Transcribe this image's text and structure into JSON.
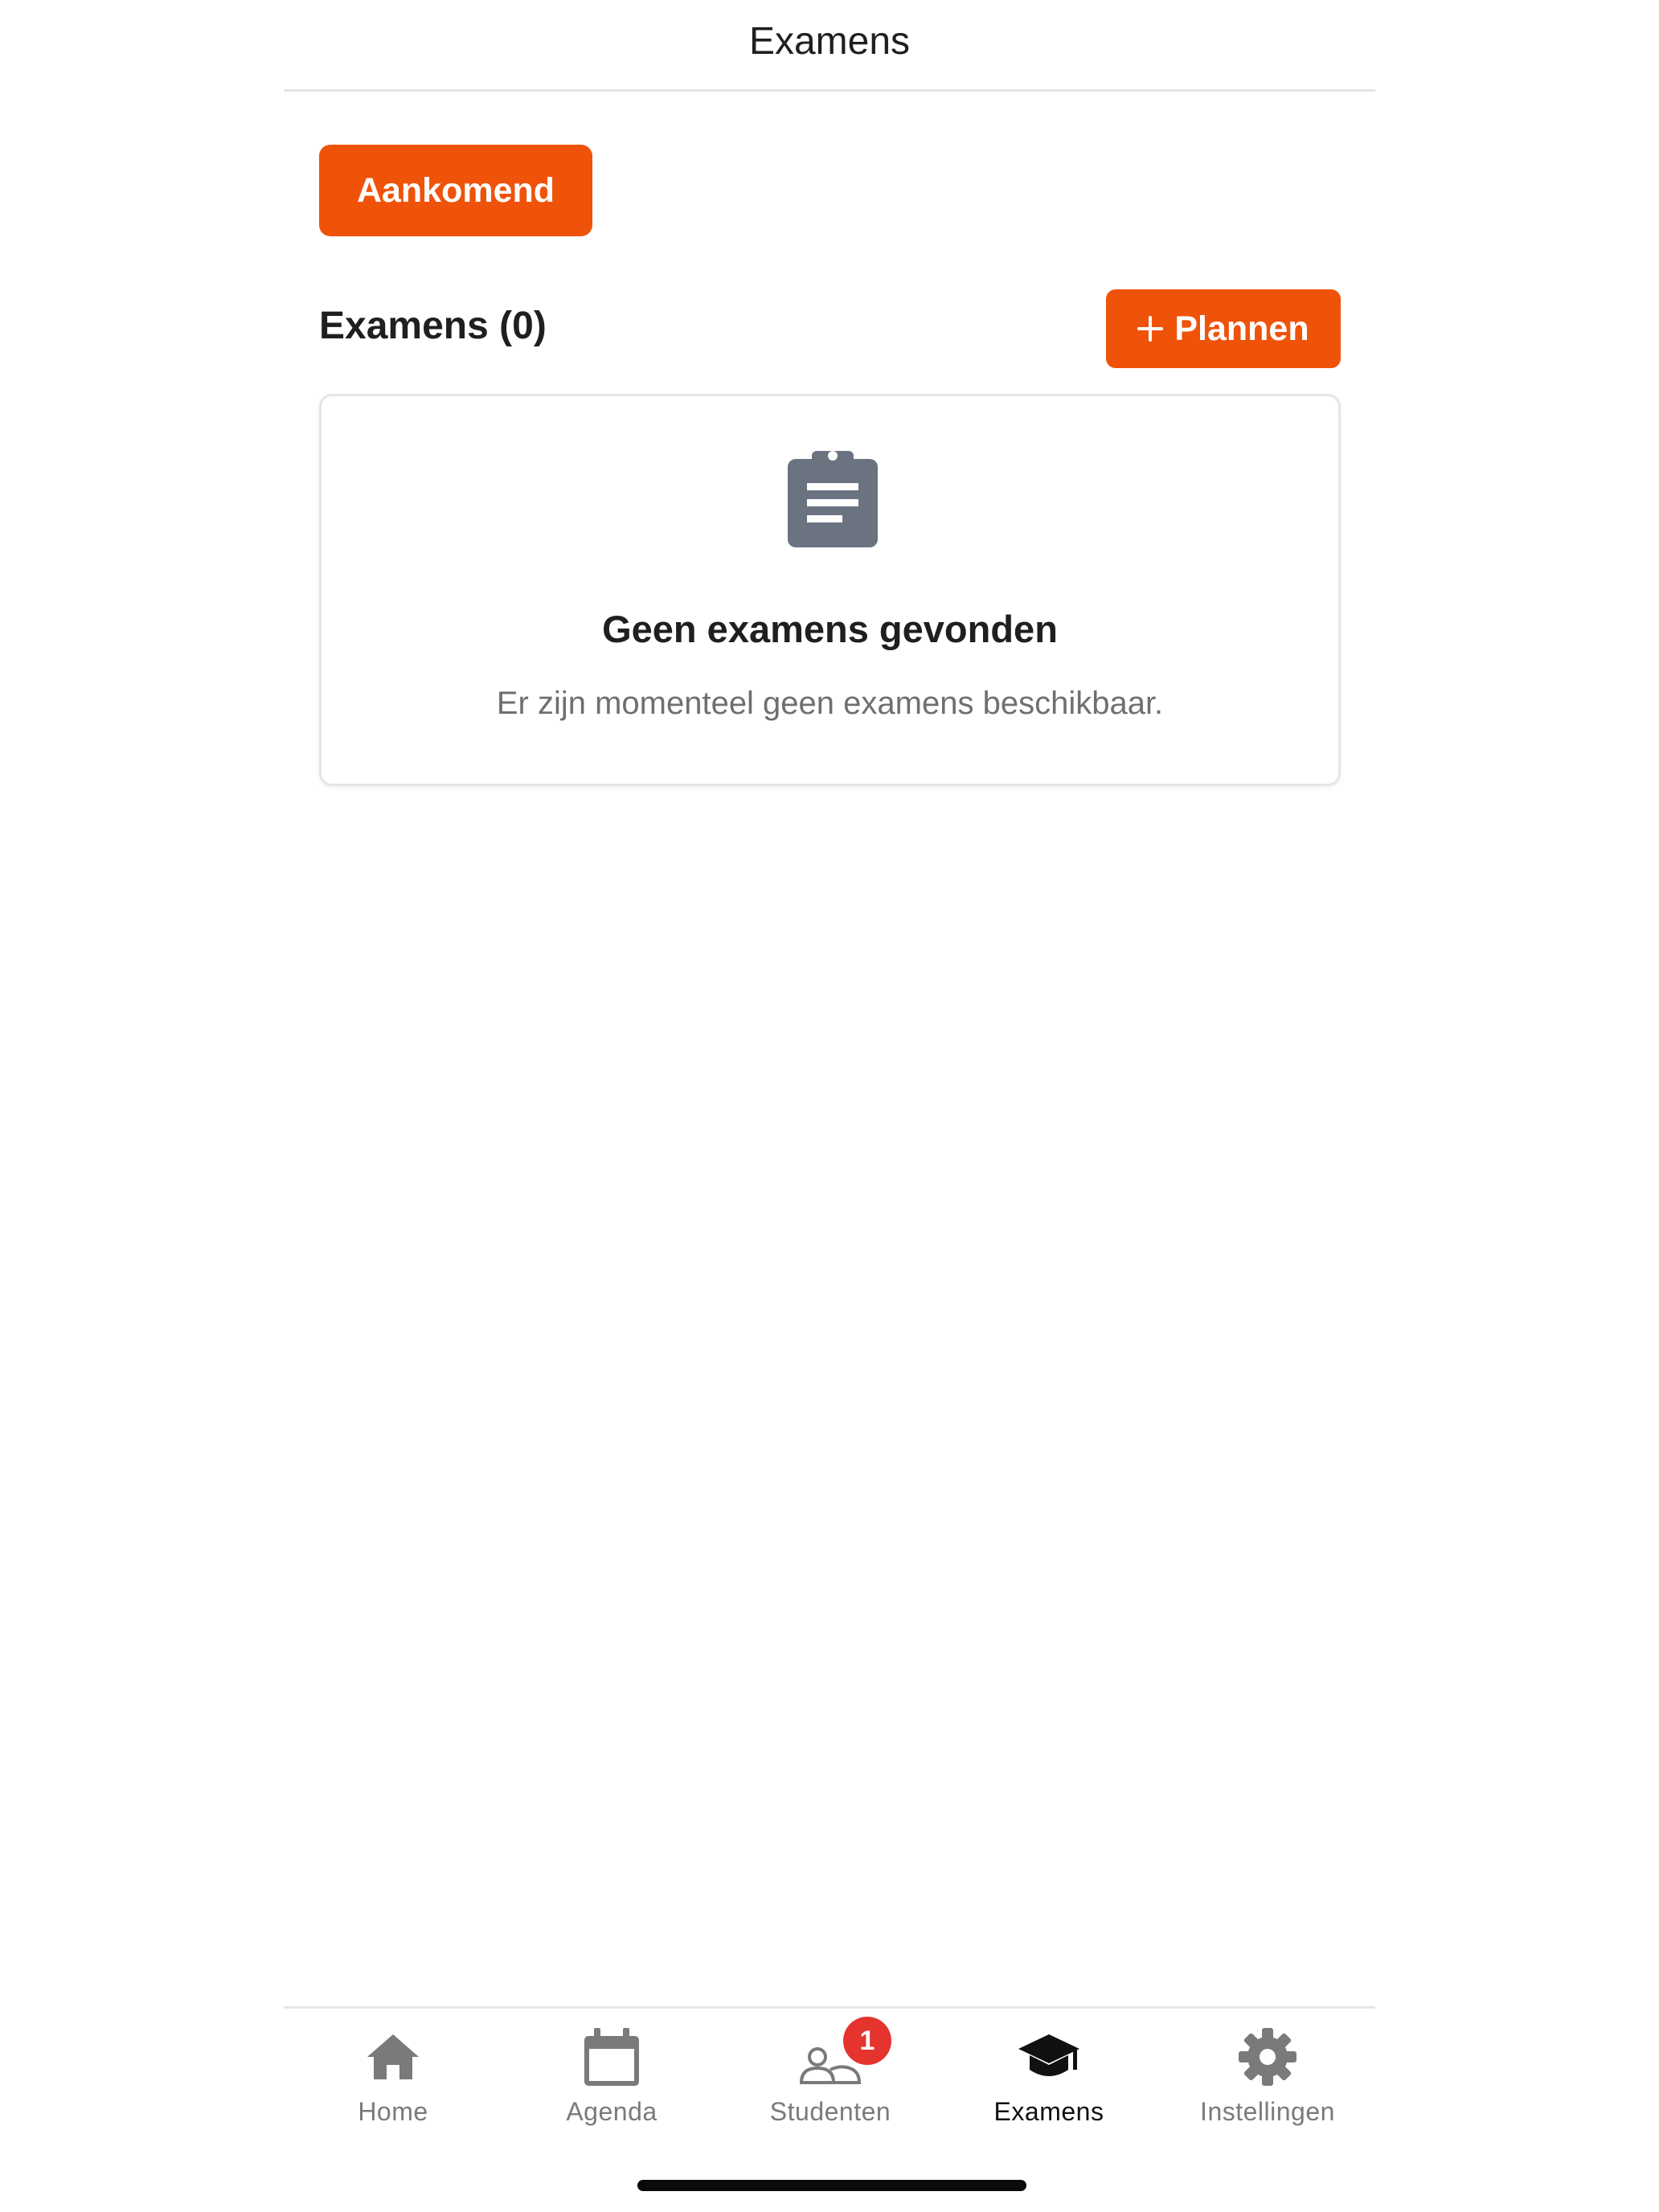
{
  "header": {
    "title": "Examens"
  },
  "filter": {
    "label": "Aankomend"
  },
  "section": {
    "title": "Examens (0)",
    "plan_button_label": "Plannen"
  },
  "empty_state": {
    "icon": "clipboard-icon",
    "title": "Geen examens gevonden",
    "description": "Er zijn momenteel geen examens beschikbaar."
  },
  "bottom_nav": {
    "items": [
      {
        "label": "Home",
        "icon": "home-icon",
        "active": false
      },
      {
        "label": "Agenda",
        "icon": "calendar-icon",
        "active": false
      },
      {
        "label": "Studenten",
        "icon": "students-icon",
        "active": false,
        "badge": "1"
      },
      {
        "label": "Examens",
        "icon": "graduation-cap-icon",
        "active": true
      },
      {
        "label": "Instellingen",
        "icon": "gear-icon",
        "active": false
      }
    ]
  },
  "colors": {
    "accent": "#ef530a",
    "badge": "#e5332e",
    "icon_inactive": "#7a7a7a",
    "icon_active": "#111111"
  }
}
